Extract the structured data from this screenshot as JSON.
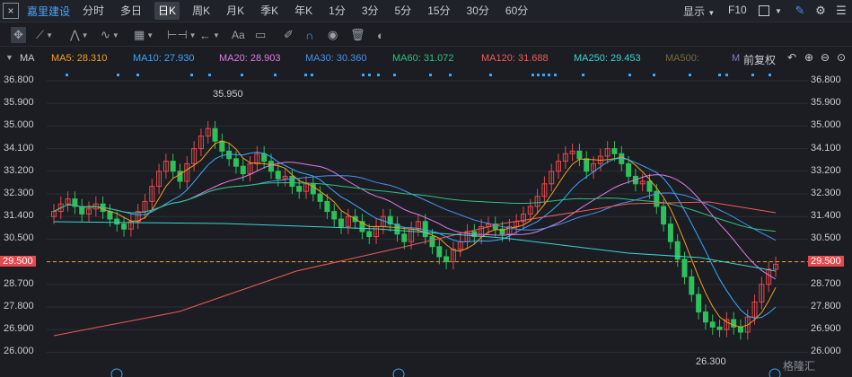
{
  "topbar": {
    "close_glyph": "×",
    "stock_name": "嘉里建设",
    "tabs": [
      "分时",
      "多日",
      "日K",
      "周K",
      "月K",
      "季K",
      "年K",
      "1分",
      "3分",
      "5分",
      "15分",
      "30分",
      "60分"
    ],
    "active_tab": "日K",
    "display_label": "显示",
    "f10_label": "F10"
  },
  "ma_legend": {
    "toggle_label": "MA",
    "items": [
      {
        "label": "MA5: 28.310",
        "color": "#f0a020"
      },
      {
        "label": "MA10: 27.930",
        "color": "#3aa8ff"
      },
      {
        "label": "MA20: 28.903",
        "color": "#e07be6"
      },
      {
        "label": "MA30: 30.360",
        "color": "#4a90f0"
      },
      {
        "label": "MA60: 31.072",
        "color": "#2ec27e"
      },
      {
        "label": "MA120: 31.688",
        "color": "#f05a5a"
      },
      {
        "label": "MA250: 29.453",
        "color": "#3ad6d6"
      },
      {
        "label": "MA500:",
        "color": "#7a6a3a"
      },
      {
        "label": "M",
        "color": "#8a7ad0"
      }
    ],
    "adjust_label": "前复权"
  },
  "chart": {
    "y_ticks": [
      "36.800",
      "35.900",
      "35.000",
      "34.100",
      "33.200",
      "32.300",
      "31.400",
      "30.500",
      "29.500",
      "28.700",
      "27.800",
      "26.900",
      "26.000"
    ],
    "current_price": "29.500",
    "high_annotation": "35.950",
    "low_annotation": "26.300",
    "watermark": "格隆汇",
    "colors": {
      "up": "#e5494d",
      "down": "#2ec05a",
      "bg": "#1b1d22",
      "grid": "#2b2e35",
      "price_line": "#f0a020"
    }
  }
}
